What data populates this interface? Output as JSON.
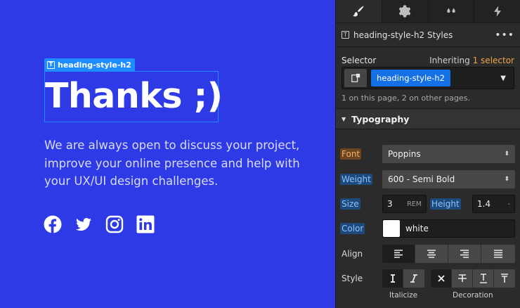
{
  "canvas": {
    "selected_tag": "heading-style-h2",
    "heading": "Thanks ;)",
    "paragraph": "We are always open to discuss your project, improve your online presence and help with your UX/UI design challenges.",
    "socials": [
      "facebook-icon",
      "twitter-icon",
      "instagram-icon",
      "linkedin-icon"
    ]
  },
  "panel": {
    "tabs": [
      "brush-icon",
      "gear-icon",
      "drops-icon",
      "bolt-icon"
    ],
    "styles_title": "heading-style-h2 Styles",
    "more": "•••",
    "selector_label": "Selector",
    "inheriting_prefix": "Inheriting",
    "inheriting_count": "1 selector",
    "selector_value": "heading-style-h2",
    "page_info": "1 on this page, 2 on other pages.",
    "section": "Typography",
    "font_label": "Font",
    "font_value": "Poppins",
    "weight_label": "Weight",
    "weight_value": "600 - Semi Bold",
    "size_label": "Size",
    "size_value": "3",
    "size_unit": "REM",
    "height_label": "Height",
    "height_value": "1.4",
    "height_unit": "-",
    "color_label": "Color",
    "color_value": "white",
    "align_label": "Align",
    "style_label": "Style",
    "italicize_label": "Italicize",
    "decoration_label": "Decoration"
  },
  "colors": {
    "canvas_bg": "#2d3ae6",
    "panel_bg": "#2b2b2b",
    "accent": "#1470e6",
    "inherit_orange": "#f0a446"
  }
}
